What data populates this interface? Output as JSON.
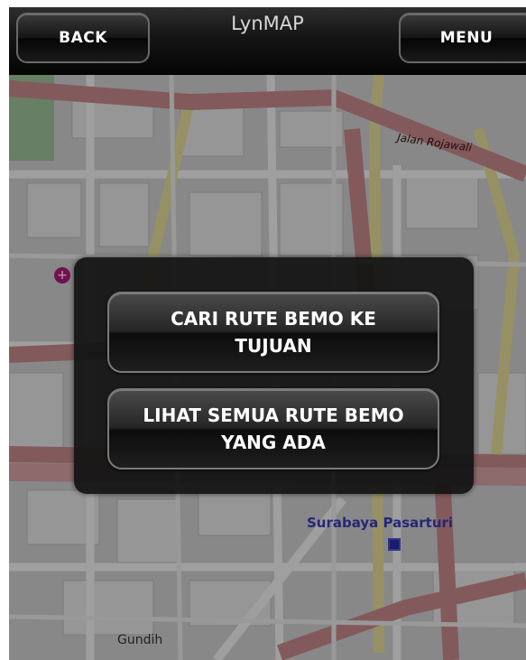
{
  "header": {
    "title": "LynMAP",
    "back_label": "BACK",
    "menu_label": "MENU"
  },
  "map": {
    "labels": {
      "rojawali": "Jalan Rojawali",
      "station": "Surabaya Pasarturi",
      "gundih": "Gundih"
    }
  },
  "dialog": {
    "cari_rute_label": "CARI RUTE BEMO KE TUJUAN",
    "lihat_rute_label": "LIHAT SEMUA RUTE BEMO YANG ADA"
  },
  "colors": {
    "header_bg": "#141414",
    "road_major": "#c86a70",
    "road_minor": "#e8e6b0",
    "map_bg": "#cfcfcf",
    "station_text": "#3b3bb8"
  }
}
